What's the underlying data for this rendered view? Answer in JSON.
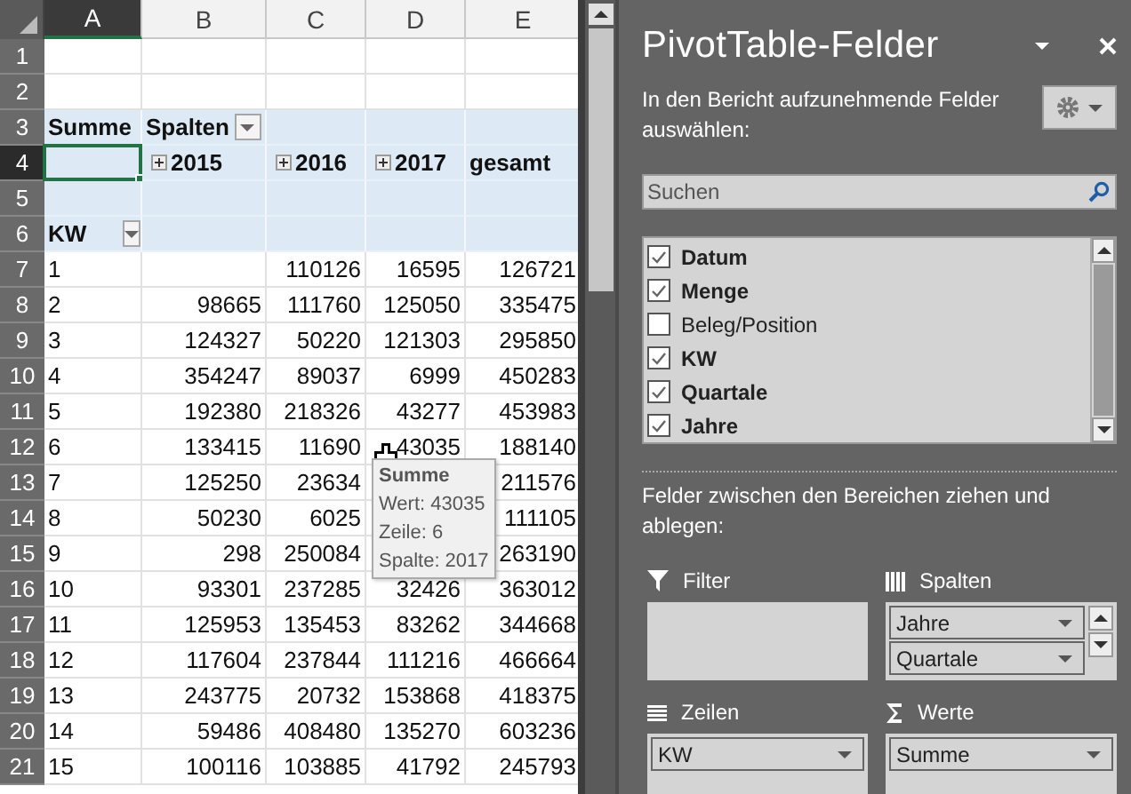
{
  "sheet": {
    "columns": [
      {
        "label": "A",
        "selected": true
      },
      {
        "label": "B",
        "selected": false
      },
      {
        "label": "C",
        "selected": false
      },
      {
        "label": "D",
        "selected": false
      },
      {
        "label": "E",
        "selected": false
      }
    ],
    "rows": [
      {
        "number": "1",
        "selected": false,
        "kind": "blank"
      },
      {
        "number": "2",
        "selected": false,
        "kind": "blank"
      },
      {
        "number": "3",
        "selected": false,
        "kind": "pivot",
        "cells": [
          {
            "text": "Summe"
          },
          {
            "text": "Spalten",
            "dropdown": true
          },
          {},
          {},
          {}
        ]
      },
      {
        "number": "4",
        "selected": true,
        "kind": "pivot",
        "cells": [
          {
            "active": true
          },
          {
            "text": "2015",
            "expand": true
          },
          {
            "text": "2016",
            "expand": true
          },
          {
            "text": "2017",
            "expand": true
          },
          {
            "text": "gesamt"
          }
        ]
      },
      {
        "number": "5",
        "selected": false,
        "kind": "pivot",
        "cells": [
          {},
          {},
          {},
          {},
          {}
        ]
      },
      {
        "number": "6",
        "selected": false,
        "kind": "pivot",
        "cells": [
          {
            "text": "KW",
            "dropdown": true
          },
          {},
          {},
          {},
          {}
        ]
      },
      {
        "number": "7",
        "selected": false,
        "kind": "data",
        "values": {
          "A": "1",
          "C": "110126",
          "D": "16595",
          "E": "126721"
        }
      },
      {
        "number": "8",
        "selected": false,
        "kind": "data",
        "values": [
          "2",
          "98665",
          "111760",
          "125050",
          "335475"
        ]
      },
      {
        "number": "9",
        "selected": false,
        "kind": "data",
        "values": [
          "3",
          "124327",
          "50220",
          "121303",
          "295850"
        ]
      },
      {
        "number": "10",
        "selected": false,
        "kind": "data",
        "values": [
          "4",
          "354247",
          "89037",
          "6999",
          "450283"
        ]
      },
      {
        "number": "11",
        "selected": false,
        "kind": "data",
        "values": [
          "5",
          "192380",
          "218326",
          "43277",
          "453983"
        ]
      },
      {
        "number": "12",
        "selected": false,
        "kind": "data",
        "values": [
          "6",
          "133415",
          "11690",
          "43035",
          "188140"
        ]
      },
      {
        "number": "13",
        "selected": false,
        "kind": "data",
        "values": {
          "A": "7",
          "B": "125250",
          "C": "23634",
          "E": "211576"
        }
      },
      {
        "number": "14",
        "selected": false,
        "kind": "data",
        "values": {
          "A": "8",
          "B": "50230",
          "C": "6025",
          "E": "111105"
        }
      },
      {
        "number": "15",
        "selected": false,
        "kind": "data",
        "values": {
          "A": "9",
          "B": "298",
          "C": "250084",
          "E": "263190"
        }
      },
      {
        "number": "16",
        "selected": false,
        "kind": "data",
        "values": [
          "10",
          "93301",
          "237285",
          "32426",
          "363012"
        ]
      },
      {
        "number": "17",
        "selected": false,
        "kind": "data",
        "values": [
          "11",
          "125953",
          "135453",
          "83262",
          "344668"
        ]
      },
      {
        "number": "18",
        "selected": false,
        "kind": "data",
        "values": [
          "12",
          "117604",
          "237844",
          "111216",
          "466664"
        ]
      },
      {
        "number": "19",
        "selected": false,
        "kind": "data",
        "values": [
          "13",
          "243775",
          "20732",
          "153868",
          "418375"
        ]
      },
      {
        "number": "20",
        "selected": false,
        "kind": "data",
        "values": [
          "14",
          "59486",
          "408480",
          "135270",
          "603236"
        ]
      },
      {
        "number": "21",
        "selected": false,
        "kind": "data",
        "values": [
          "15",
          "100116",
          "103885",
          "41792",
          "245793"
        ]
      }
    ],
    "tooltip": {
      "title": "Summe",
      "lines": [
        "Wert: 43035",
        "Zeile: 6",
        "Spalte: 2017"
      ]
    }
  },
  "panel": {
    "title": "PivotTable-Felder",
    "instructions": "In den Bericht aufzunehmende Felder auswählen:",
    "search": {
      "placeholder": "Suchen"
    },
    "fields": [
      {
        "label": "Datum",
        "checked": true
      },
      {
        "label": "Menge",
        "checked": true
      },
      {
        "label": "Beleg/Position",
        "checked": false
      },
      {
        "label": "KW",
        "checked": true
      },
      {
        "label": "Quartale",
        "checked": true
      },
      {
        "label": "Jahre",
        "checked": true
      }
    ],
    "areas_hint": "Felder zwischen den Bereichen ziehen und ablegen:",
    "areas": [
      {
        "kind": "filter",
        "label": "Filter"
      },
      {
        "kind": "columns",
        "label": "Spalten",
        "items": [
          "Jahre",
          "Quartale"
        ]
      },
      {
        "kind": "rows",
        "label": "Zeilen",
        "items": [
          "KW"
        ]
      },
      {
        "kind": "values",
        "label": "Werte",
        "items": [
          "Summe"
        ]
      }
    ]
  }
}
